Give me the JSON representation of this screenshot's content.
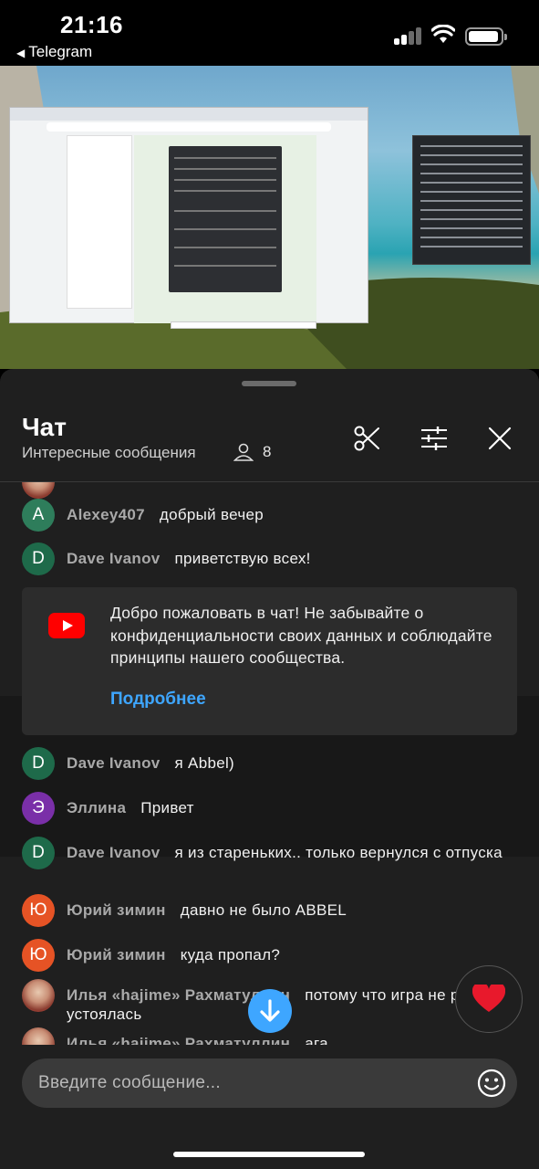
{
  "status_bar": {
    "time": "21:16",
    "back_app": "Telegram"
  },
  "chat_header": {
    "title": "Чат",
    "subtitle": "Интересные сообщения",
    "viewer_count": "8"
  },
  "messages": [
    {
      "author": "Alexey407",
      "text": "добрый вечер",
      "avatar_letter": "A",
      "avatar_color": "#2e7d5b"
    },
    {
      "author": "Dave Ivanov",
      "text": "приветствую всех!",
      "avatar_letter": "D",
      "avatar_color": "#1e6a4a"
    },
    {
      "author": "Dave Ivanov",
      "text": "я Abbel)",
      "avatar_letter": "D",
      "avatar_color": "#1e6a4a"
    },
    {
      "author": "Эллина",
      "text": "Привет",
      "avatar_letter": "Э",
      "avatar_color": "#7a2fa8"
    },
    {
      "author": "Dave Ivanov",
      "text": "я из стареньких.. только вернулся с отпуска",
      "avatar_letter": "D",
      "avatar_color": "#1e6a4a"
    },
    {
      "author": "Юрий зимин",
      "text": "давно не было ABBEL",
      "avatar_letter": "Ю",
      "avatar_color": "#e65325"
    },
    {
      "author": "Юрий зимин",
      "text": "куда пропал?",
      "avatar_letter": "Ю",
      "avatar_color": "#e65325"
    },
    {
      "author": "Илья «hajime» Рахматуллин",
      "text": "потому что игра не ре устоялась",
      "avatar_letter": "",
      "avatar_color": "#b44"
    },
    {
      "author": "Илья «hajime» Рахматуллин",
      "text": "ага",
      "avatar_letter": "",
      "avatar_color": "#b44"
    }
  ],
  "welcome_notice": {
    "text": "Добро пожаловать в чат! Не забывайте о конфиденциальности своих данных и соблюдайте принципы нашего сообщества.",
    "link_label": "Подробнее"
  },
  "composer": {
    "placeholder": "Введите сообщение..."
  },
  "colors": {
    "accent_blue": "#3ea6ff",
    "youtube_red": "#ff0000",
    "panel_bg": "#1f1f1f"
  },
  "icons": [
    "back-arrow-icon",
    "signal-icon",
    "wifi-icon",
    "battery-icon",
    "viewers-icon",
    "scissors-icon",
    "filter-sliders-icon",
    "close-icon",
    "youtube-icon",
    "scroll-down-icon",
    "heart-icon",
    "emoji-icon"
  ]
}
